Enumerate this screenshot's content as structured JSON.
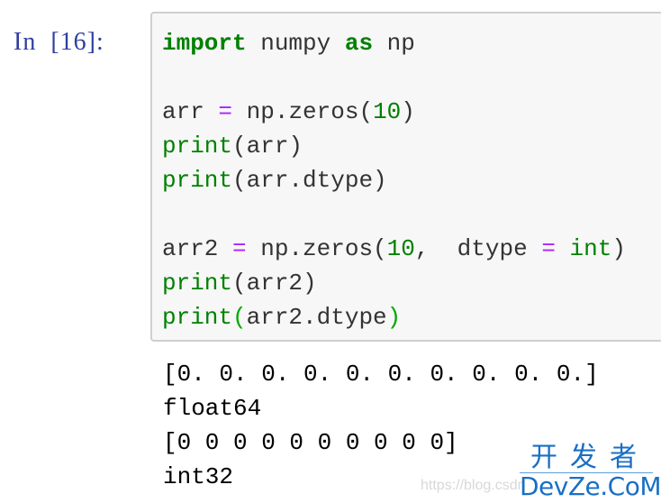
{
  "cell": {
    "prompt": "In  [16]:",
    "execution_count": 16,
    "code_lines": [
      [
        {
          "t": "import",
          "c": "kw"
        },
        {
          "t": " numpy ",
          "c": ""
        },
        {
          "t": "as",
          "c": "kw"
        },
        {
          "t": " np",
          "c": ""
        }
      ],
      [],
      [
        {
          "t": "arr ",
          "c": ""
        },
        {
          "t": "=",
          "c": "op"
        },
        {
          "t": " np.zeros(",
          "c": ""
        },
        {
          "t": "10",
          "c": "num"
        },
        {
          "t": ")",
          "c": ""
        }
      ],
      [
        {
          "t": "print",
          "c": "bi"
        },
        {
          "t": "(arr)",
          "c": ""
        }
      ],
      [
        {
          "t": "print",
          "c": "bi"
        },
        {
          "t": "(arr.dtype)",
          "c": ""
        }
      ],
      [],
      [
        {
          "t": "arr2 ",
          "c": ""
        },
        {
          "t": "=",
          "c": "op"
        },
        {
          "t": " np.zeros(",
          "c": ""
        },
        {
          "t": "10",
          "c": "num"
        },
        {
          "t": ",  dtype ",
          "c": ""
        },
        {
          "t": "=",
          "c": "op"
        },
        {
          "t": " ",
          "c": ""
        },
        {
          "t": "int",
          "c": "bi"
        },
        {
          "t": ")",
          "c": ""
        }
      ],
      [
        {
          "t": "print",
          "c": "bi"
        },
        {
          "t": "(arr2)",
          "c": ""
        }
      ],
      [
        {
          "t": "print",
          "c": "bi"
        },
        {
          "t": "(",
          "c": "mb"
        },
        {
          "t": "arr2.dtype",
          "c": ""
        },
        {
          "t": ")",
          "c": "mb"
        }
      ]
    ],
    "output_lines": [
      "[0. 0. 0. 0. 0. 0. 0. 0. 0. 0.]",
      "float64",
      "[0 0 0 0 0 0 0 0 0 0]",
      "int32"
    ]
  },
  "watermark": {
    "url_text": "https://blog.csdn",
    "logo_cn": "开发者",
    "logo_en": "DevZe.CoM"
  },
  "colors": {
    "prompt": "#303f9f",
    "keyword": "#008000",
    "operator": "#aa22ff",
    "cell_bg": "#f7f7f7",
    "cell_border": "#cfcfcf",
    "watermark_logo": "#1a6fc4"
  }
}
